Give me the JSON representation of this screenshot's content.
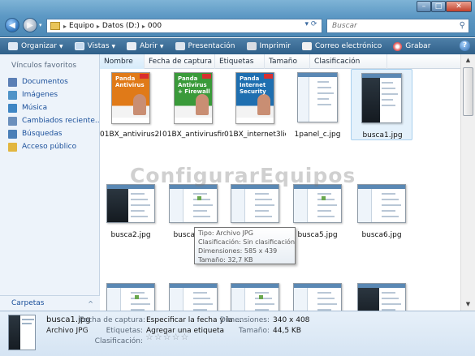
{
  "window": {
    "address_crumbs": [
      "Equipo",
      "Datos (D:)",
      "000"
    ],
    "search_placeholder": "Buscar",
    "controls": {
      "minimize": "–",
      "maximize": "□",
      "close": "✕"
    }
  },
  "toolbar": {
    "items": [
      {
        "label": "Organizar",
        "icon": "organize-icon",
        "has_menu": true
      },
      {
        "label": "Vistas",
        "icon": "views-icon",
        "has_menu": true
      },
      {
        "label": "Abrir",
        "icon": "open-icon",
        "has_menu": true
      },
      {
        "label": "Presentación",
        "icon": "slideshow-icon",
        "has_menu": false
      },
      {
        "label": "Imprimir",
        "icon": "print-icon",
        "has_menu": false
      },
      {
        "label": "Correo electrónico",
        "icon": "email-icon",
        "has_menu": false
      },
      {
        "label": "Grabar",
        "icon": "burn-icon",
        "has_menu": false
      }
    ],
    "help": "?"
  },
  "sidebar": {
    "heading": "Vínculos favoritos",
    "items": [
      {
        "label": "Documentos",
        "icon": "documents-icon",
        "color": "#5b7fb5"
      },
      {
        "label": "Imágenes",
        "icon": "pictures-icon",
        "color": "#4f93c8"
      },
      {
        "label": "Música",
        "icon": "music-icon",
        "color": "#3f86c4"
      },
      {
        "label": "Cambiados recientemente",
        "display": "Cambiados reciente...",
        "icon": "recent-icon",
        "color": "#6b8fbc"
      },
      {
        "label": "Búsquedas",
        "icon": "searches-icon",
        "color": "#4a7fb8"
      },
      {
        "label": "Acceso público",
        "icon": "public-folder-icon",
        "color": "#e2b640"
      }
    ],
    "folders_label": "Carpetas",
    "folders_toggle": "^"
  },
  "columns": [
    "Nombre",
    "Fecha de captura",
    "Etiquetas",
    "Tamaño",
    "Clasificación"
  ],
  "files": [
    {
      "name": "01BX_antivirus2li...",
      "kind": "box",
      "color": "#e07a18",
      "brand": "Panda Antivirus"
    },
    {
      "name": "01BX_antivirusfir...",
      "kind": "box",
      "color": "#3a9a3a",
      "brand": "Panda Antivirus + Firewall"
    },
    {
      "name": "01BX_internet3lic...",
      "kind": "box",
      "color": "#1f6fb0",
      "brand": "Panda Internet Security"
    },
    {
      "name": "1panel_c.jpg",
      "kind": "shot-light"
    },
    {
      "name": "busca1.jpg",
      "kind": "shot-dark",
      "selected": true
    },
    {
      "name": "busca2.jpg",
      "kind": "shot-dark"
    },
    {
      "name": "busca3.jpg",
      "kind": "shot-light"
    },
    {
      "name": "busca4.jpg",
      "kind": "shot-light"
    },
    {
      "name": "busca5.jpg",
      "kind": "shot-light"
    },
    {
      "name": "busca6.jpg",
      "kind": "shot-light"
    },
    {
      "name": "",
      "kind": "shot-light"
    },
    {
      "name": "",
      "kind": "shot-light"
    },
    {
      "name": "",
      "kind": "shot-light"
    },
    {
      "name": "",
      "kind": "shot-light"
    },
    {
      "name": "",
      "kind": "shot-dark"
    }
  ],
  "watermark": "ConfigurarEquipos",
  "tooltip": {
    "lines": [
      "Tipo: Archivo JPG",
      "Clasificación: Sin clasificación",
      "Dimensiones: 585 x 439",
      "Tamaño: 32,7 KB"
    ]
  },
  "details": {
    "name": "busca1.jpg",
    "type": "Archivo JPG",
    "fecha_label": "Fecha de captura:",
    "fecha_value": "Especificar la fecha y la ...",
    "etiquetas_label": "Etiquetas:",
    "etiquetas_value": "Agregar una etiqueta",
    "clasificacion_label": "Clasificación:",
    "dimensiones_label": "Dimensiones:",
    "dimensiones_value": "340 x 408",
    "tamano_label": "Tamaño:",
    "tamano_value": "44,5 KB",
    "rating_stars": 0,
    "rating_max": 5
  }
}
